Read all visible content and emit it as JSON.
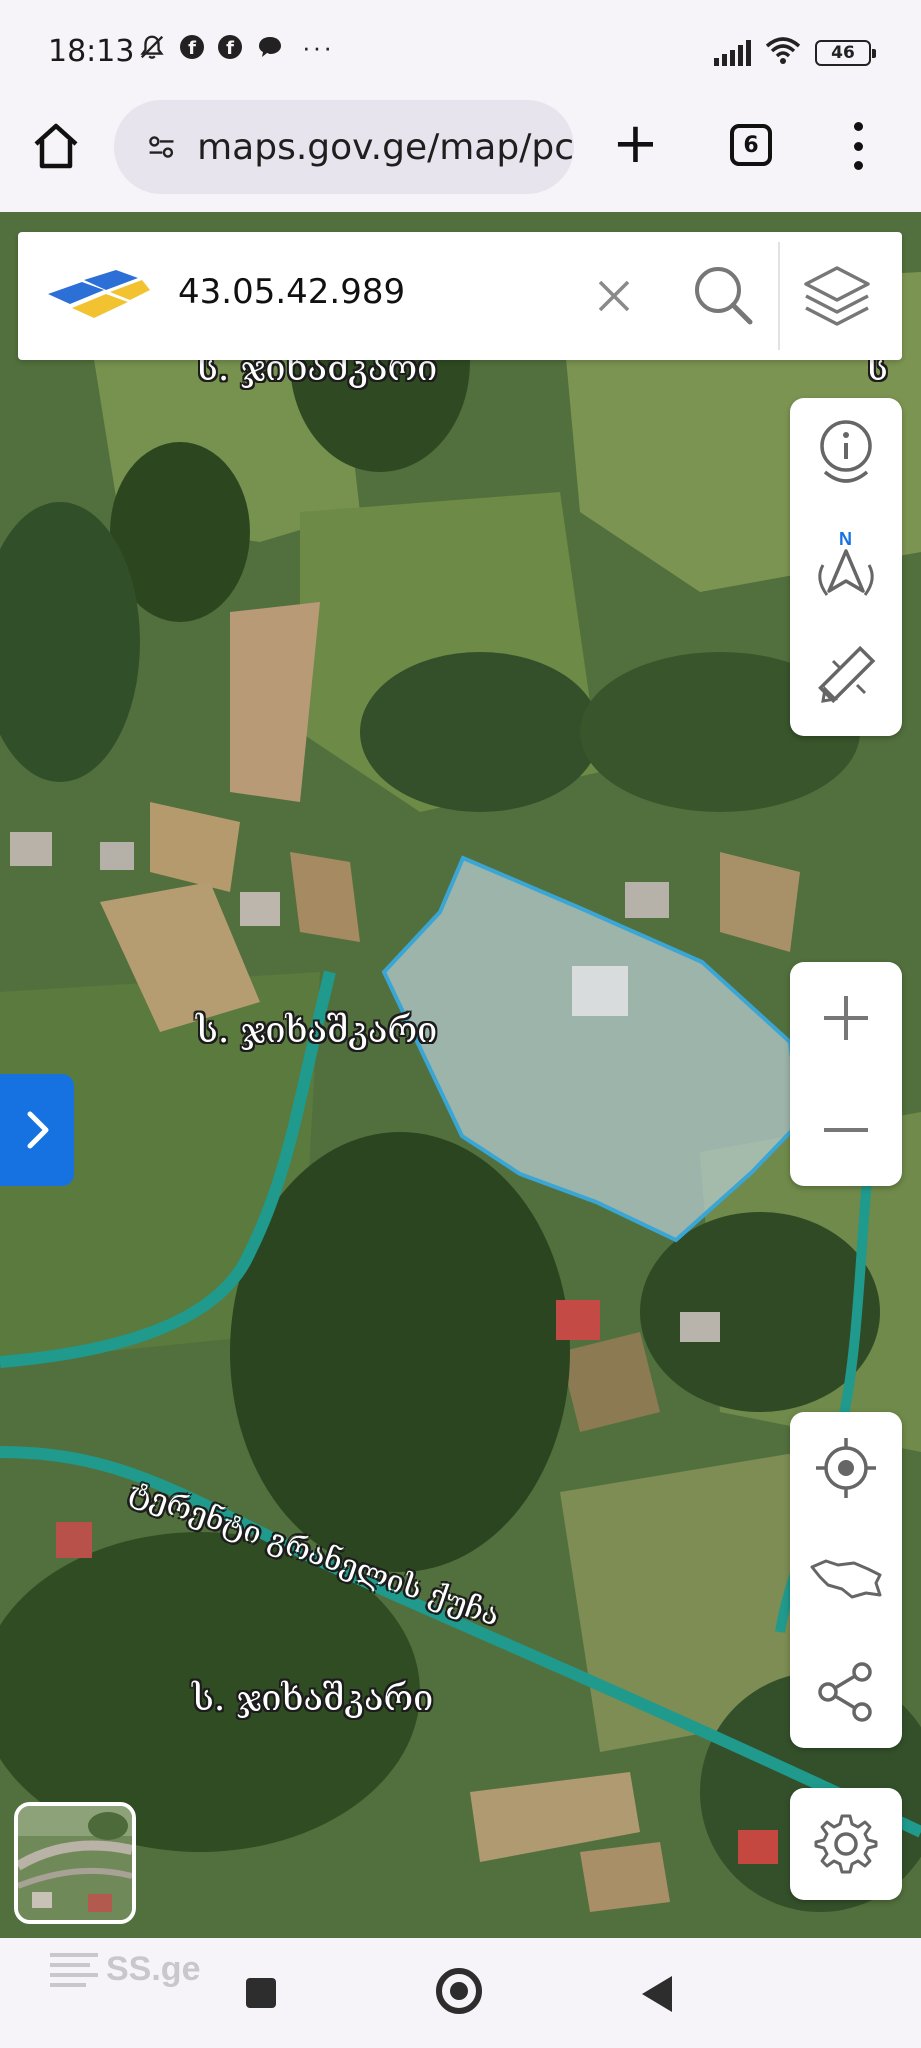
{
  "status_bar": {
    "time": "18:13",
    "more": "···",
    "battery": "46",
    "icons": [
      "mute-icon",
      "facebook-icon",
      "facebook-icon",
      "chat-icon",
      "signal-icon",
      "wifi-icon",
      "battery-icon"
    ]
  },
  "browser": {
    "url": "maps.gov.ge/map/pc",
    "tab_count": "6",
    "new_tab_label": "+"
  },
  "search": {
    "value": "43.05.42.989"
  },
  "map": {
    "labels": {
      "village_top": "ს. ჯიხაშკარი",
      "village_top_right": "ს",
      "village_middle": "ს. ჯიხაშკარი",
      "village_bottom": "ს. ჯიხაშკარი",
      "street": "ტერენტი გრანელის ქუჩა"
    },
    "colors": {
      "parcel_fill": "#b9cfd2",
      "parcel_border": "#3aa6d6",
      "stream": "#1f9a8c",
      "accent": "#1672e0"
    }
  },
  "tools": {
    "top_group": [
      "info-pin-icon",
      "north-compass-icon",
      "measure-ruler-icon"
    ],
    "zoom_group": [
      "zoom-in-icon",
      "zoom-out-icon"
    ],
    "bottom_group": [
      "locate-me-icon",
      "georgia-map-icon",
      "share-icon"
    ],
    "settings": "gear-icon"
  },
  "watermark": {
    "text": "SS.ge"
  }
}
